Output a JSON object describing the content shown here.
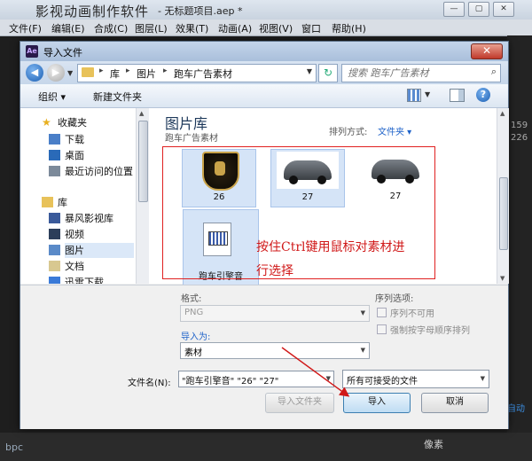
{
  "app": {
    "brand": "影视动画制作软件",
    "filename": "- 无标题项目.aep *",
    "menu": [
      "文件(F)",
      "编辑(E)",
      "合成(C)",
      "图层(L)",
      "效果(T)",
      "动画(A)",
      "视图(V)",
      "窗口",
      "帮助(H)"
    ],
    "right_numbers": [
      "159",
      "226"
    ],
    "auto_label": "自动",
    "bottom_pixel_label": "像素",
    "bottom_left": "bpc"
  },
  "dialog": {
    "title": "导入文件",
    "breadcrumb": [
      "库",
      "图片",
      "跑车广告素材"
    ],
    "search_placeholder": "搜索 跑车广告素材",
    "toolbar": {
      "organize": "组织 ▾",
      "new_folder": "新建文件夹"
    },
    "sidebar": {
      "favorites_header": "收藏夹",
      "favorites": [
        "下载",
        "桌面",
        "最近访问的位置"
      ],
      "libraries_header": "库",
      "libraries": [
        "暴风影视库",
        "视频",
        "图片",
        "文档",
        "迅雷下载"
      ]
    },
    "library_title": "图片库",
    "library_subtitle": "跑车广告素材",
    "sort_label": "排列方式:",
    "sort_value": "文件夹 ▾",
    "items": [
      {
        "caption": "26",
        "kind": "logo"
      },
      {
        "caption": "27",
        "kind": "car"
      },
      {
        "caption": "27",
        "kind": "car"
      },
      {
        "caption": "跑车引擎音",
        "kind": "audio"
      }
    ],
    "annotation": "按住Ctrl键用鼠标对素材进行选择",
    "format_label": "格式:",
    "format_value": "PNG",
    "import_as_label": "导入为:",
    "import_as_value": "素材",
    "sequence_options_label": "序列选项:",
    "sequence_unavailable": "序列不可用",
    "force_alpha": "强制按字母顺序排列",
    "filename_label": "文件名(N):",
    "filename_value": "\"跑车引擎音\" \"26\" \"27\"",
    "filter_value": "所有可接受的文件",
    "import_folder_button": "导入文件夹",
    "import_button": "导入",
    "cancel_button": "取消"
  },
  "colors": {
    "annotation": "#d01818",
    "accent": "#1e62c9"
  }
}
